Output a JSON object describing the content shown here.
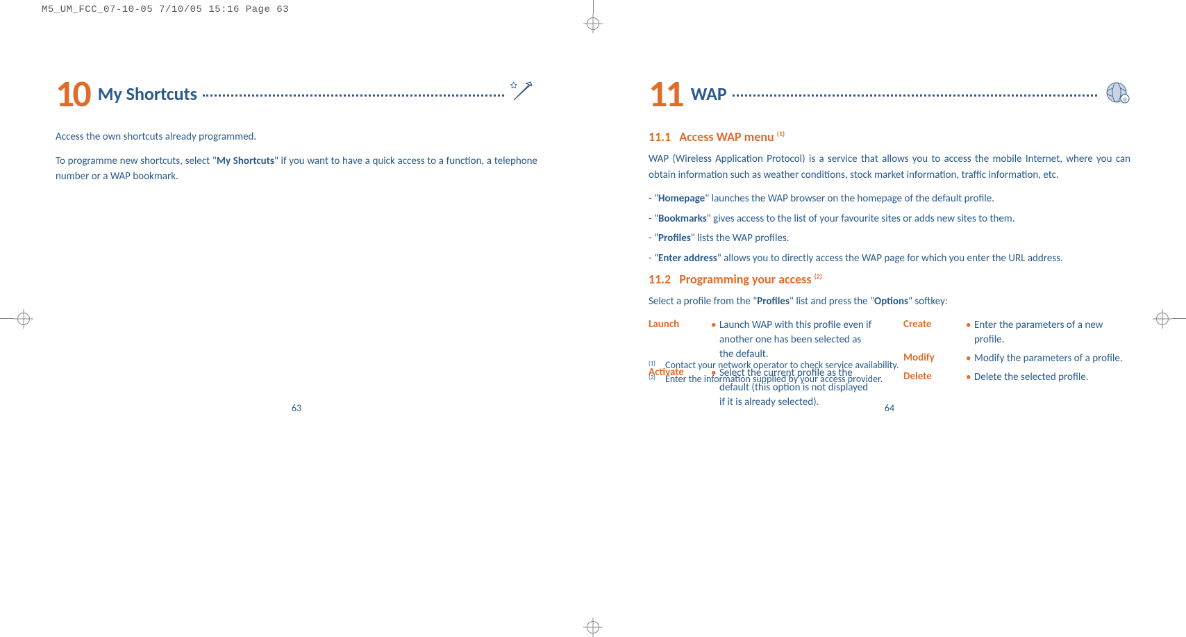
{
  "print_header": "M5_UM_FCC_07-10-05  7/10/05  15:16  Page 63",
  "left": {
    "chapter_number": "10",
    "chapter_title": "My Shortcuts",
    "p1": "Access the own shortcuts already programmed.",
    "p2a": "To programme new shortcuts, select \"",
    "p2b": "My Shortcuts",
    "p2c": "\" if you want to have a quick access to a function, a telephone number or a WAP bookmark.",
    "page_num": "63"
  },
  "right": {
    "chapter_number": "11",
    "chapter_title": "WAP",
    "sec1_num": "11.1",
    "sec1_title": "Access WAP menu ",
    "sec1_sup": "(1)",
    "sec1_p": "WAP (Wireless Application Protocol) is a service that allows you to access the mobile Internet, where you can obtain information such as weather conditions, stock market information, traffic information, etc.",
    "li1a": "- \"",
    "li1b": "Homepage",
    "li1c": "\" launches the WAP browser on the homepage of the default profile.",
    "li2a": "- \"",
    "li2b": "Bookmarks",
    "li2c": "\" gives access to the list of your favourite sites or adds new sites to them.",
    "li3a": "- \"",
    "li3b": "Profiles",
    "li3c": "\" lists the WAP profiles.",
    "li4a": "- \"",
    "li4b": "Enter address",
    "li4c": "\" allows you to directly access the WAP page for which you enter the URL address.",
    "sec2_num": "11.2",
    "sec2_title": "Programming your access ",
    "sec2_sup": "(2)",
    "sec2_p_a": "Select a profile from the \"",
    "sec2_p_b": "Profiles",
    "sec2_p_c": "\" list and press the \"",
    "sec2_p_d": "Options",
    "sec2_p_e": "\" softkey:",
    "opts": {
      "launch_l": "Launch",
      "launch_d": "Launch WAP with this profile even if another one has been selected as the default.",
      "activate_l": "Activate",
      "activate_d": "Select the current profile as the default (this option is not displayed if it is already selected).",
      "create_l": "Create",
      "create_d": "Enter the parameters of a new profile.",
      "modify_l": "Modify",
      "modify_d": "Modify the parameters of a profile.",
      "delete_l": "Delete",
      "delete_d": "Delete the selected profile."
    },
    "fn1_mark": "(1)",
    "fn1": "Contact your network operator to check service availability.",
    "fn2_mark": "(2)",
    "fn2": "Enter the information supplied by your access provider.",
    "page_num": "64"
  }
}
